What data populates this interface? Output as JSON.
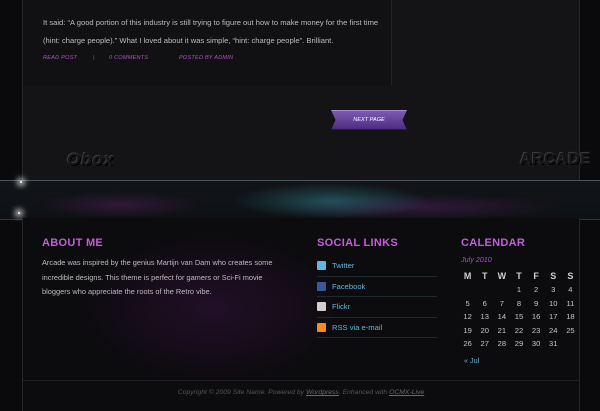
{
  "post": {
    "text": "It said: “A good portion of this industry is still trying to figure out how to make money for the first time (hint: charge people).” What I loved about it was simple, “hint: charge people”. Brilliant.",
    "read_post": "Read Post",
    "separator": "|",
    "comments": "0 Comments",
    "posted_by": "Posted by Admin"
  },
  "pagination": {
    "next_label": "Next Page"
  },
  "logos": {
    "left": "Obox",
    "right": "ARCADE"
  },
  "about": {
    "title": "About Me",
    "text": "Arcade was inspired by the genius Martijn van Dam who creates some incredible designs. This theme is perfect for gamers or Sci-Fi movie bloggers who appreciate the roots of the Retro vibe."
  },
  "social": {
    "title": "Social Links",
    "items": [
      {
        "label": "Twitter",
        "icon": "twitter-icon",
        "color": "#5fb6e0"
      },
      {
        "label": "Facebook",
        "icon": "facebook-icon",
        "color": "#3b5998"
      },
      {
        "label": "Flickr",
        "icon": "flickr-icon",
        "color": "#d0d0d0"
      },
      {
        "label": "RSS via e-mail",
        "icon": "rss-icon",
        "color": "#f28c1e"
      }
    ]
  },
  "calendar": {
    "title": "Calendar",
    "caption": "July 2010",
    "days": [
      "M",
      "T",
      "W",
      "T",
      "F",
      "S",
      "S"
    ],
    "weeks": [
      [
        "",
        "",
        "",
        "1",
        "2",
        "3",
        "4"
      ],
      [
        "5",
        "6",
        "7",
        "8",
        "9",
        "10",
        "11"
      ],
      [
        "12",
        "13",
        "14",
        "15",
        "16",
        "17",
        "18"
      ],
      [
        "19",
        "20",
        "21",
        "22",
        "23",
        "24",
        "25"
      ],
      [
        "26",
        "27",
        "28",
        "29",
        "30",
        "31",
        ""
      ]
    ],
    "prev_label": "« Jul"
  },
  "footer": {
    "copy_prefix": "Copyright © 2009 Site Name. Powered by ",
    "wordpress": "Wordpress",
    "copy_mid": ". Enhanced with ",
    "ocmx": "OCMX-Live"
  },
  "colors": {
    "accent": "#c25fd9",
    "link": "#62b7d9",
    "button": "#5b3a96"
  }
}
